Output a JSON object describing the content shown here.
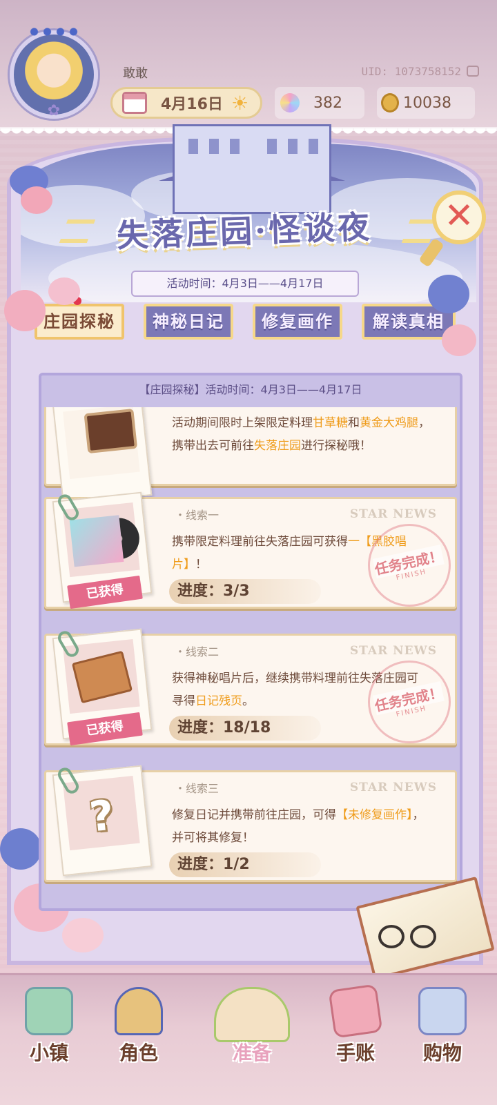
{
  "header": {
    "player_name": "敢敢",
    "uid": "UID: 1073758152",
    "date": "4月16日",
    "gems": "382",
    "coins": "10038"
  },
  "event": {
    "title": "失落庄园·怪谈夜",
    "period": "活动时间：4月3日——4月17日"
  },
  "tabs": [
    {
      "label": "庄园探秘",
      "active": true
    },
    {
      "label": "神秘日记",
      "active": false
    },
    {
      "label": "修复画作",
      "active": false
    },
    {
      "label": "解读真相",
      "active": false
    }
  ],
  "panel": {
    "header": "【庄园探秘】活动时间：4月3日——4月17日",
    "intro": {
      "p1": "活动期间限时上架限定料理",
      "hl1": "甘草糖",
      "p2": "和",
      "hl2": "黄金大鸡腿",
      "p3": "，携带出去可前往",
      "hl3": "失落庄园",
      "p4": "进行探秘哦！"
    },
    "clues": [
      {
        "label": "・线索一",
        "brand": "STAR NEWS",
        "desc_a": "携带限定料理前往失落庄园可获得",
        "desc_hl": "一【黑胶唱片】",
        "desc_b": "！",
        "progress": "进度：3/3",
        "badge": "已获得",
        "stamp": "任务完成！",
        "stamp_sub": "FINISH"
      },
      {
        "label": "・线索二",
        "brand": "STAR NEWS",
        "desc_a": "获得神秘唱片后，继续携带料理前往失落庄园可寻得",
        "desc_hl": "日记残页",
        "desc_b": "。",
        "progress": "进度：18/18",
        "badge": "已获得",
        "stamp": "任务完成！",
        "stamp_sub": "FINISH"
      },
      {
        "label": "・线索三",
        "brand": "STAR NEWS",
        "desc_a": "修复日记并携带前往庄园，可得",
        "desc_hl": "【未修复画作】",
        "desc_b": "，并可将其修复！",
        "progress": "进度：1/2",
        "question": "?"
      }
    ]
  },
  "nav": {
    "town": "小镇",
    "role": "角色",
    "prepare": "准备",
    "journal": "手账",
    "shop": "购物"
  },
  "colors": {
    "accent": "#7c78b6",
    "highlight": "#ef9c1b",
    "badge": "#e46a8a"
  }
}
